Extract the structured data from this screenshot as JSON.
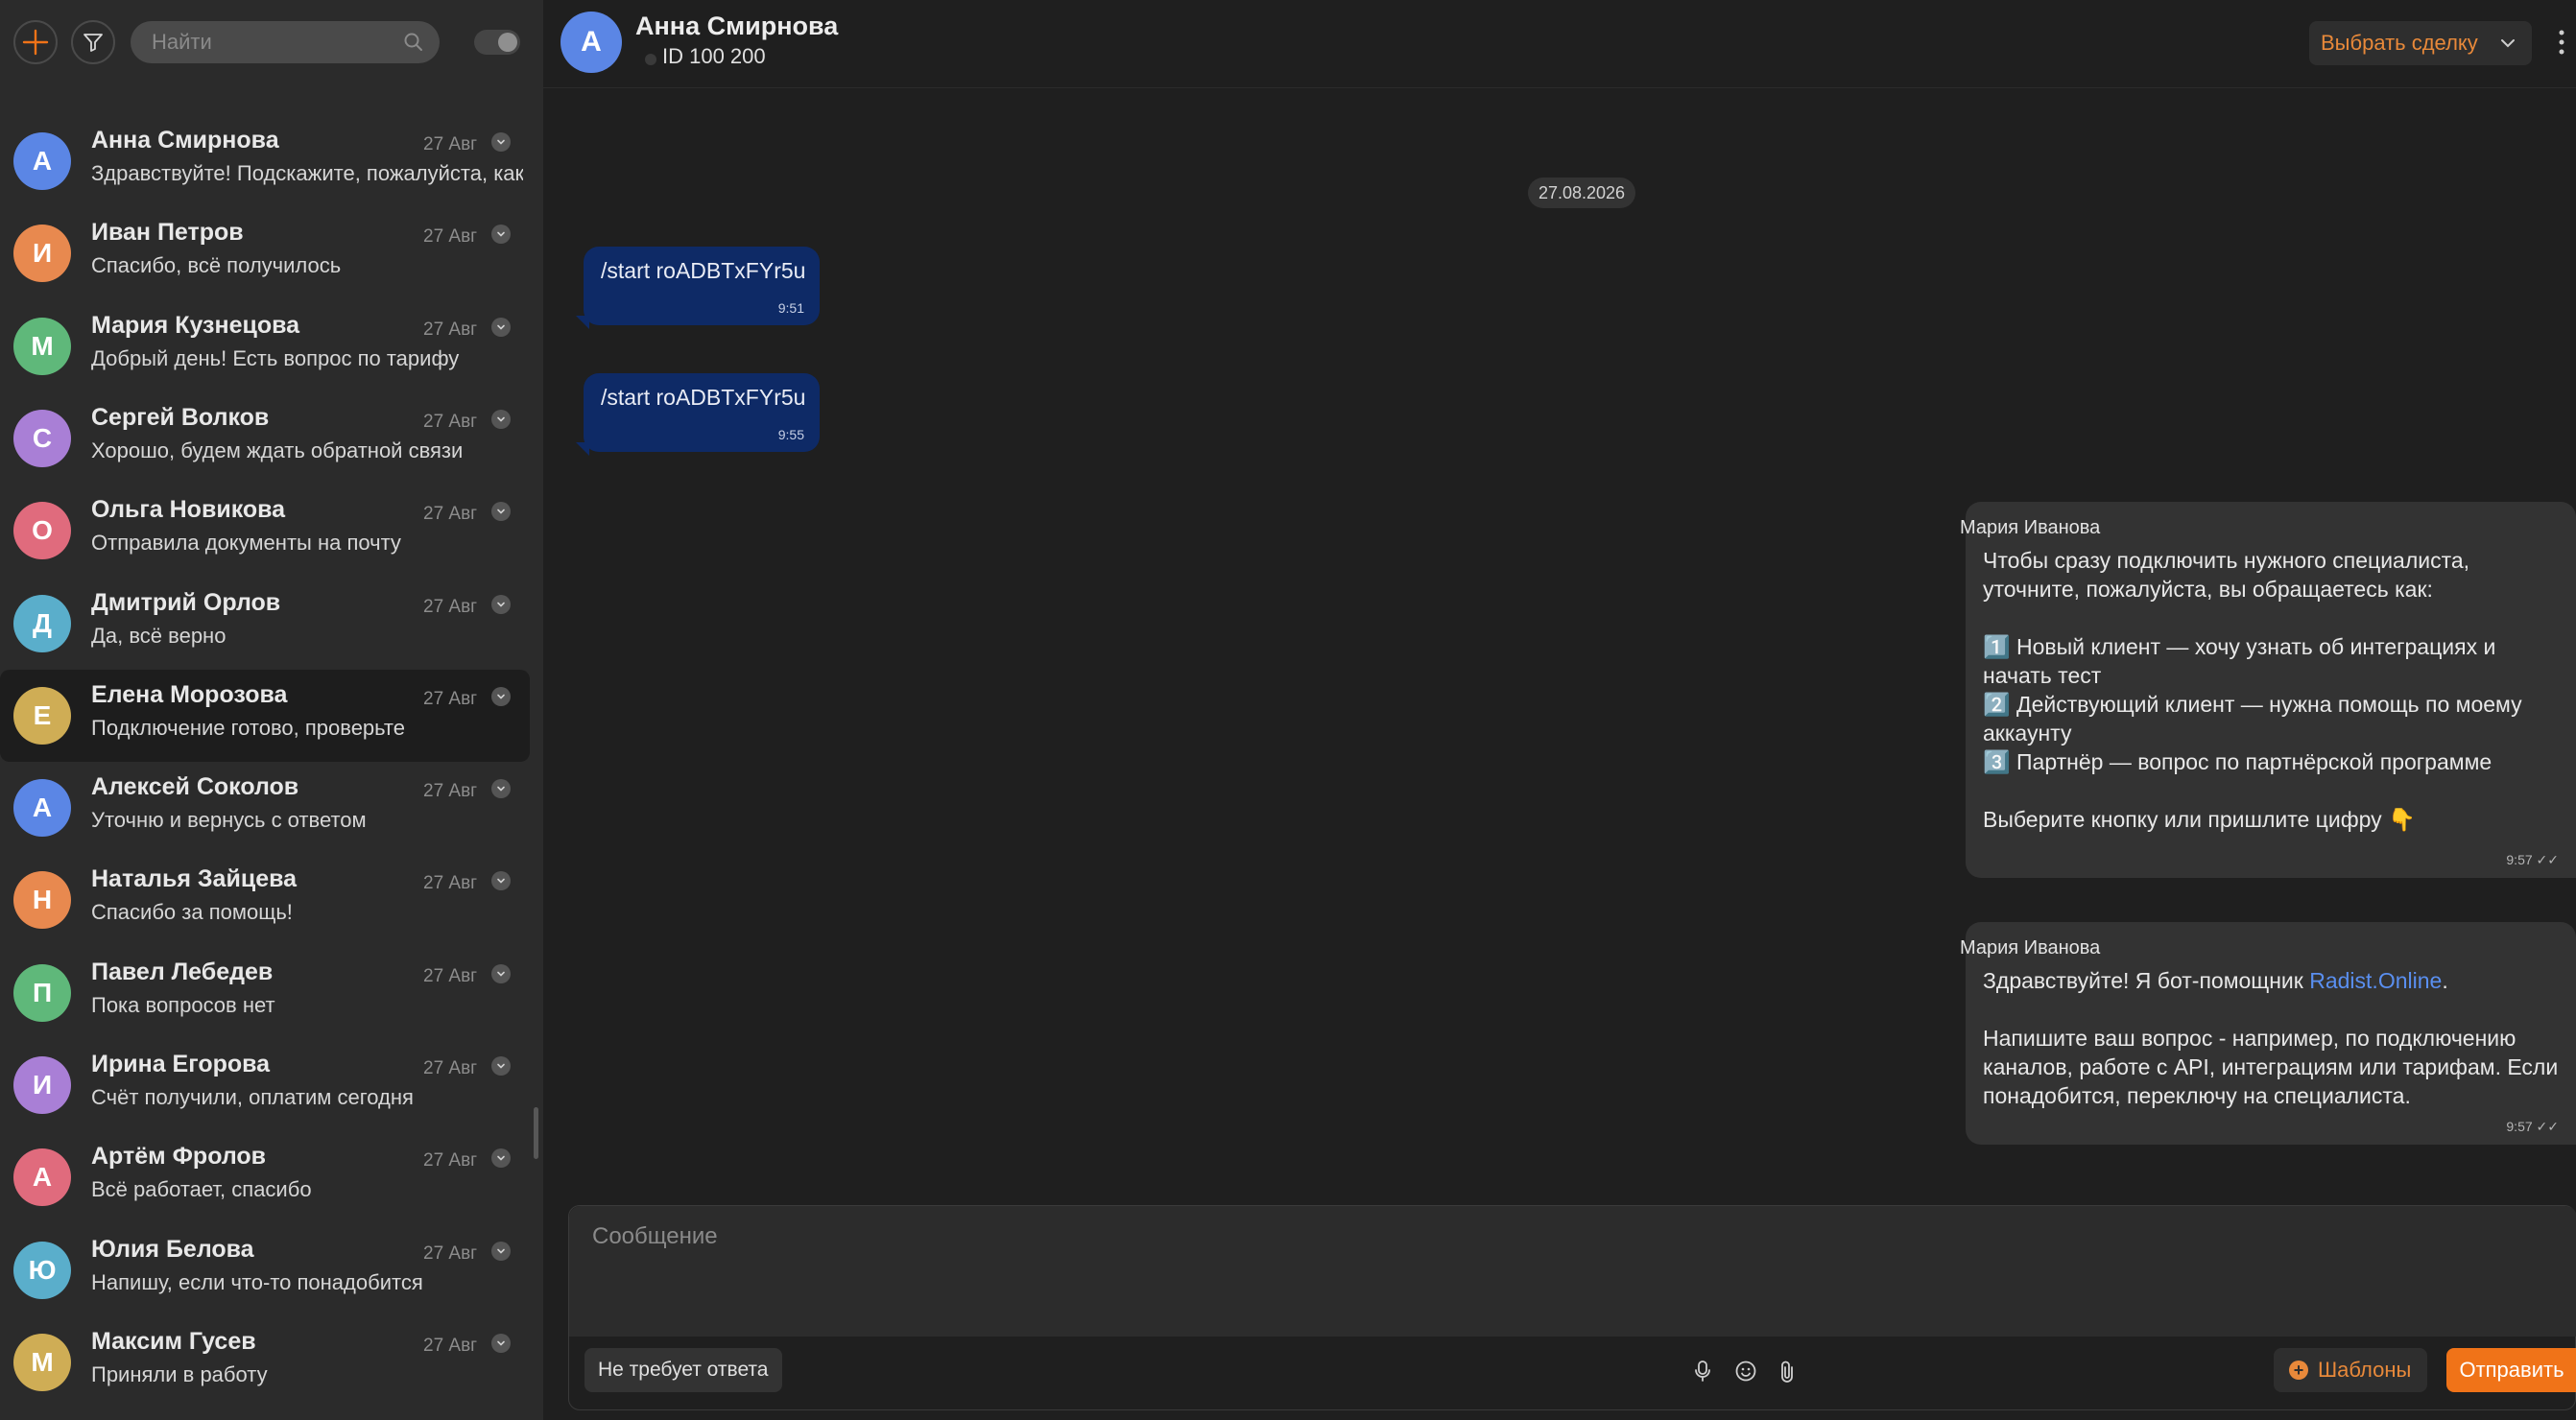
{
  "sidebar": {
    "search_placeholder": "Найти",
    "chats": [
      {
        "initial": "А",
        "name": "Анна Смирнова",
        "preview": "Здравствуйте! Подскажите, пожалуйста, как",
        "date": "27 Авг",
        "color": "#5b86e5"
      },
      {
        "initial": "И",
        "name": "Иван Петров",
        "preview": "Спасибо, всё получилось",
        "date": "27 Авг",
        "color": "#e8894f"
      },
      {
        "initial": "М",
        "name": "Мария Кузнецова",
        "preview": "Добрый день! Есть вопрос по тарифу",
        "date": "27 Авг",
        "color": "#5fb87a"
      },
      {
        "initial": "С",
        "name": "Сергей Волков",
        "preview": "Хорошо, будем ждать обратной связи",
        "date": "27 Авг",
        "color": "#a97fd6"
      },
      {
        "initial": "О",
        "name": "Ольга Новикова",
        "preview": "Отправила документы на почту",
        "date": "27 Авг",
        "color": "#e06b7d"
      },
      {
        "initial": "Д",
        "name": "Дмитрий Орлов",
        "preview": "Да, всё верно",
        "date": "27 Авг",
        "color": "#5aaecb"
      },
      {
        "initial": "Е",
        "name": "Елена Морозова",
        "preview": "Подключение готово, проверьте",
        "date": "27 Авг",
        "color": "#cfad55"
      },
      {
        "initial": "А",
        "name": "Алексей Соколов",
        "preview": "Уточню и вернусь с ответом",
        "date": "27 Авг",
        "color": "#5b86e5"
      },
      {
        "initial": "Н",
        "name": "Наталья Зайцева",
        "preview": "Спасибо за помощь!",
        "date": "27 Авг",
        "color": "#e8894f"
      },
      {
        "initial": "П",
        "name": "Павел Лебедев",
        "preview": "Пока вопросов нет",
        "date": "27 Авг",
        "color": "#5fb87a"
      },
      {
        "initial": "И",
        "name": "Ирина Егорова",
        "preview": "Счёт получили, оплатим сегодня",
        "date": "27 Авг",
        "color": "#a97fd6"
      },
      {
        "initial": "А",
        "name": "Артём Фролов",
        "preview": "Всё работает, спасибо",
        "date": "27 Авг",
        "color": "#e06b7d"
      },
      {
        "initial": "Ю",
        "name": "Юлия Белова",
        "preview": "Напишу, если что-то понадобится",
        "date": "27 Авг",
        "color": "#5aaecb"
      },
      {
        "initial": "М",
        "name": "Максим Гусев",
        "preview": "Приняли в работу",
        "date": "27 Авг",
        "color": "#cfad55"
      }
    ]
  },
  "header": {
    "initial": "А",
    "name": "Анна Смирнова",
    "id_text": "ID 100 200",
    "deal_select_label": "Выбрать сделку"
  },
  "messages": {
    "date": "27.08.2026",
    "outgoing": [
      {
        "text": "/start roADBTxFYr5u",
        "time": "9:51"
      },
      {
        "text": "/start roADBTxFYr5u",
        "time": "9:55"
      }
    ],
    "bot1": {
      "sender": "Мария Иванова",
      "lines": [
        "Чтобы сразу подключить нужного специалиста,",
        "уточните, пожалуйста, вы обращаетесь как:",
        "",
        "1️⃣ Новый клиент — хочу узнать об интеграциях и",
        "начать тест",
        "2️⃣ Действующий клиент — нужна помощь по моему",
        "аккаунту",
        "3️⃣ Партнёр — вопрос по партнёрской программе",
        "",
        "Выберите кнопку или пришлите цифру 👇"
      ],
      "time": "9:57"
    },
    "bot2": {
      "sender": "Мария Иванова",
      "line1_prefix": "Здравствуйте! Я бот-помощник ",
      "link": "Radist.Online",
      "line1_suffix": ".",
      "lines": [
        "",
        "Напишите ваш вопрос - например, по подключению",
        "каналов, работе с API, интеграциям или тарифам. Если",
        "понадобится, переключу на специалиста."
      ],
      "time": "9:57"
    }
  },
  "composer": {
    "placeholder": "Сообщение",
    "no_reply_label": "Не требует ответа",
    "templates_label": "Шаблоны",
    "send_label": "Отправить"
  },
  "colors": {
    "accent": "#f07318",
    "accent_text": "#e8893a",
    "outgoing_bubble": "#0e2a66",
    "incoming_bubble": "#333333",
    "link": "#5a8ff0"
  }
}
